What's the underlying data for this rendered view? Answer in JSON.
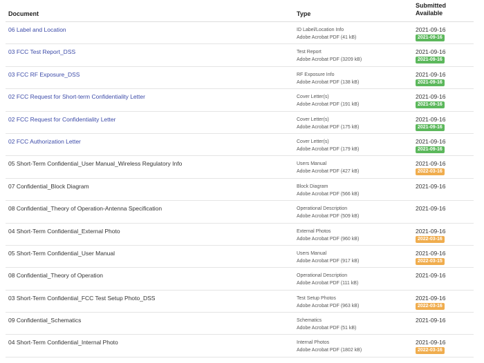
{
  "header": {
    "document": "Document",
    "type": "Type",
    "submitted": "Submitted",
    "available": "Available"
  },
  "colors": {
    "link": "#3b4aa8",
    "badge_green": "#5cb85c",
    "badge_orange": "#f0ad4e"
  },
  "rows": [
    {
      "name": "06 Label and Location",
      "link": true,
      "type": "ID Label/Location Info",
      "file": "Adobe Acrobat PDF (41 kB)",
      "submitted": "2021-09-16",
      "available": "2021-09-16",
      "status": "green"
    },
    {
      "name": "03 FCC Test Report_DSS",
      "link": true,
      "type": "Test Report",
      "file": "Adobe Acrobat PDF (3209 kB)",
      "submitted": "2021-09-16",
      "available": "2021-09-16",
      "status": "green"
    },
    {
      "name": "03 FCC RF Exposure_DSS",
      "link": true,
      "type": "RF Exposure Info",
      "file": "Adobe Acrobat PDF (138 kB)",
      "submitted": "2021-09-16",
      "available": "2021-09-16",
      "status": "green"
    },
    {
      "name": "02 FCC Request for Short-term Confidentiality Letter",
      "link": true,
      "type": "Cover Letter(s)",
      "file": "Adobe Acrobat PDF (191 kB)",
      "submitted": "2021-09-16",
      "available": "2021-09-16",
      "status": "green"
    },
    {
      "name": "02 FCC Request for Confidentiality Letter",
      "link": true,
      "type": "Cover Letter(s)",
      "file": "Adobe Acrobat PDF (175 kB)",
      "submitted": "2021-09-16",
      "available": "2021-09-16",
      "status": "green"
    },
    {
      "name": "02 FCC Authorization Letter",
      "link": true,
      "type": "Cover Letter(s)",
      "file": "Adobe Acrobat PDF (179 kB)",
      "submitted": "2021-09-16",
      "available": "2021-09-16",
      "status": "green"
    },
    {
      "name": "05 Short-Term Confidential_User Manual_Wireless Regulatory Info",
      "link": false,
      "type": "Users Manual",
      "file": "Adobe Acrobat PDF (427 kB)",
      "submitted": "2021-09-16",
      "available": "2022-03-16",
      "status": "orange"
    },
    {
      "name": "07 Confidential_Block Diagram",
      "link": false,
      "type": "Block Diagram",
      "file": "Adobe Acrobat PDF (566 kB)",
      "submitted": "2021-09-16",
      "available": "",
      "status": "none"
    },
    {
      "name": "08 Confidential_Theory of Operation-Antenna Specification",
      "link": false,
      "type": "Operational Description",
      "file": "Adobe Acrobat PDF (509 kB)",
      "submitted": "2021-09-16",
      "available": "",
      "status": "none"
    },
    {
      "name": "04 Short-Term Confidential_External Photo",
      "link": false,
      "type": "External Photos",
      "file": "Adobe Acrobat PDF (960 kB)",
      "submitted": "2021-09-16",
      "available": "2022-03-16",
      "status": "orange"
    },
    {
      "name": "05 Short-Term Confidential_User Manual",
      "link": false,
      "type": "Users Manual",
      "file": "Adobe Acrobat PDF (917 kB)",
      "submitted": "2021-09-16",
      "available": "2022-03-15",
      "status": "orange"
    },
    {
      "name": "08 Confidential_Theory of Operation",
      "link": false,
      "type": "Operational Description",
      "file": "Adobe Acrobat PDF (111 kB)",
      "submitted": "2021-09-16",
      "available": "",
      "status": "none"
    },
    {
      "name": "03 Short-Term Confidential_FCC Test Setup Photo_DSS",
      "link": false,
      "type": "Test Setup Photos",
      "file": "Adobe Acrobat PDF (963 kB)",
      "submitted": "2021-09-16",
      "available": "2022-03-16",
      "status": "orange"
    },
    {
      "name": "09 Confidential_Schematics",
      "link": false,
      "type": "Schematics",
      "file": "Adobe Acrobat PDF (51 kB)",
      "submitted": "2021-09-16",
      "available": "",
      "status": "none"
    },
    {
      "name": "04 Short-Term Confidential_Internal Photo",
      "link": false,
      "type": "Internal Photos",
      "file": "Adobe Acrobat PDF (1802 kB)",
      "submitted": "2021-09-16",
      "available": "2022-03-16",
      "status": "orange"
    }
  ]
}
